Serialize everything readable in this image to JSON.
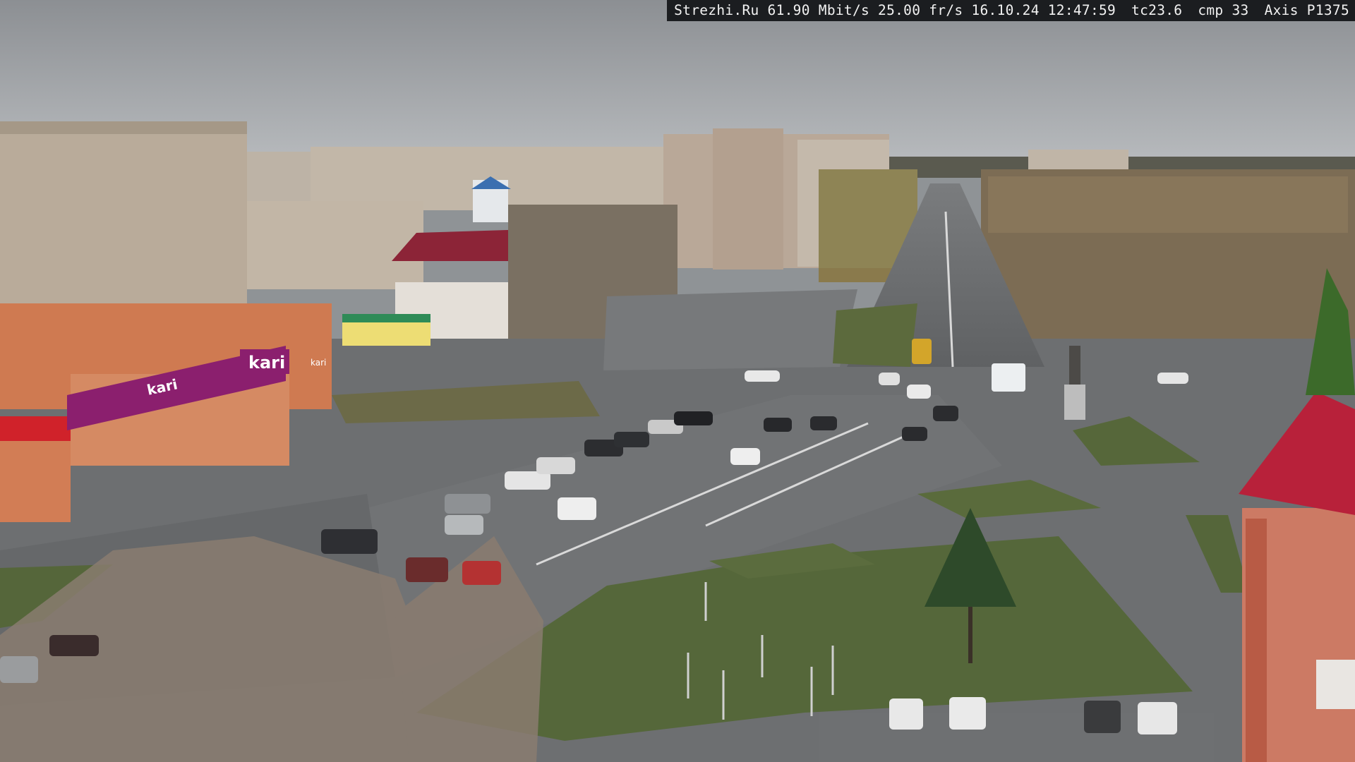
{
  "overlay": {
    "site": "Strezhi.Ru",
    "bitrate": "61.90 Mbit/s",
    "framerate": "25.00 fr/s",
    "date": "16.10.24",
    "time": "12:47:59",
    "temperature": "tc23.6",
    "compression": "cmp 33",
    "camera_model": "Axis P1375"
  },
  "signs": {
    "store_main": "kari",
    "store_secondary": "kari",
    "store_side": "kari"
  },
  "colors": {
    "sky": "#a7aaad",
    "asphalt": "#6f7173",
    "grass": "#56683b",
    "panel_building": "#b9ab9a",
    "orange_building": "#d07a52",
    "kari_magenta": "#8b1f6e",
    "red_roof": "#b8213a"
  }
}
